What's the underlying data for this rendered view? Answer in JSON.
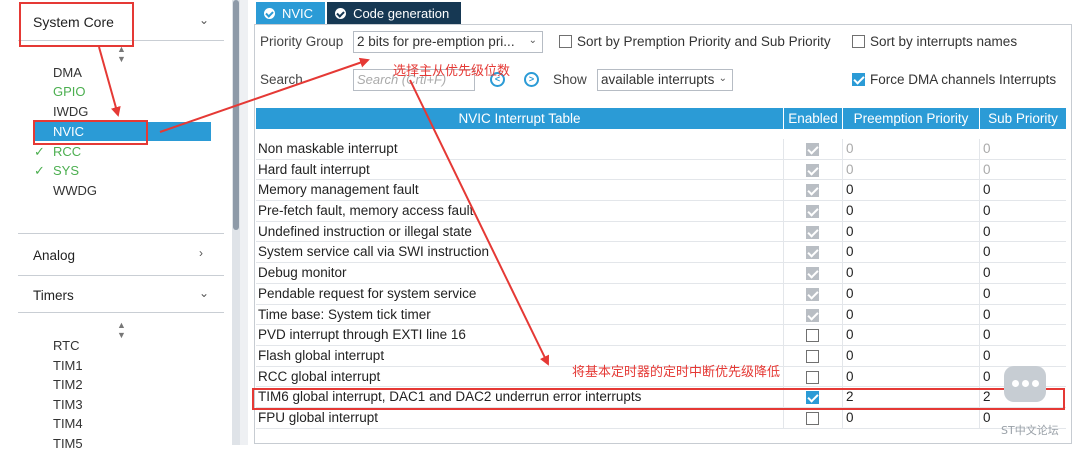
{
  "sidebar": {
    "system_core": {
      "title": "System Core",
      "items": [
        {
          "label": "DMA",
          "status": "none"
        },
        {
          "label": "GPIO",
          "status": "green"
        },
        {
          "label": "IWDG",
          "status": "none"
        },
        {
          "label": "NVIC",
          "status": "selected"
        },
        {
          "label": "RCC",
          "status": "checked"
        },
        {
          "label": "SYS",
          "status": "checked"
        },
        {
          "label": "WWDG",
          "status": "none"
        }
      ]
    },
    "analog": {
      "title": "Analog"
    },
    "timers": {
      "title": "Timers",
      "items": [
        "RTC",
        "TIM1",
        "TIM2",
        "TIM3",
        "TIM4",
        "TIM5"
      ]
    }
  },
  "tabs": [
    {
      "label": "NVIC"
    },
    {
      "label": "Code generation"
    }
  ],
  "options": {
    "priority_group_label": "Priority Group",
    "priority_group_value": "2 bits for pre-emption pri...",
    "sort_premption_label": "Sort by Premption Priority and Sub Priority",
    "sort_premption_checked": false,
    "sort_names_label": "Sort by interrupts names",
    "sort_names_checked": false,
    "search_label": "Search",
    "search_placeholder": "Search (Crtl+F)",
    "show_label": "Show",
    "show_value": "available interrupts",
    "force_dma_label": "Force DMA channels Interrupts",
    "force_dma_checked": true
  },
  "table": {
    "headers": [
      "NVIC Interrupt Table",
      "Enabled",
      "Preemption Priority",
      "Sub Priority"
    ],
    "rows": [
      {
        "name": "Non maskable interrupt",
        "enabled": true,
        "locked": true,
        "preemption": "0",
        "sub": "0",
        "dim": true
      },
      {
        "name": "Hard fault interrupt",
        "enabled": true,
        "locked": true,
        "preemption": "0",
        "sub": "0",
        "dim": true
      },
      {
        "name": "Memory management fault",
        "enabled": true,
        "locked": true,
        "preemption": "0",
        "sub": "0",
        "dim": false
      },
      {
        "name": "Pre-fetch fault, memory access fault",
        "enabled": true,
        "locked": true,
        "preemption": "0",
        "sub": "0",
        "dim": false
      },
      {
        "name": "Undefined instruction or illegal state",
        "enabled": true,
        "locked": true,
        "preemption": "0",
        "sub": "0",
        "dim": false
      },
      {
        "name": "System service call via SWI instruction",
        "enabled": true,
        "locked": true,
        "preemption": "0",
        "sub": "0",
        "dim": false
      },
      {
        "name": "Debug monitor",
        "enabled": true,
        "locked": true,
        "preemption": "0",
        "sub": "0",
        "dim": false
      },
      {
        "name": "Pendable request for system service",
        "enabled": true,
        "locked": true,
        "preemption": "0",
        "sub": "0",
        "dim": false
      },
      {
        "name": "Time base: System tick timer",
        "enabled": true,
        "locked": true,
        "preemption": "0",
        "sub": "0",
        "dim": false
      },
      {
        "name": "PVD interrupt through EXTI line 16",
        "enabled": false,
        "locked": false,
        "preemption": "0",
        "sub": "0",
        "dim": false
      },
      {
        "name": "Flash global interrupt",
        "enabled": false,
        "locked": false,
        "preemption": "0",
        "sub": "0",
        "dim": false
      },
      {
        "name": "RCC global interrupt",
        "enabled": false,
        "locked": false,
        "preemption": "0",
        "sub": "0",
        "dim": false
      },
      {
        "name": "TIM6 global interrupt, DAC1 and DAC2 underrun error interrupts",
        "enabled": true,
        "locked": false,
        "preemption": "2",
        "sub": "2",
        "dim": false
      },
      {
        "name": "FPU global interrupt",
        "enabled": false,
        "locked": false,
        "preemption": "0",
        "sub": "0",
        "dim": false
      }
    ]
  },
  "annotations": {
    "priority_note": "选择主从优先级位数",
    "timer_note": "将基本定时器的定时中断优先级降低",
    "watermark": "ST中文论坛",
    "color": "#e53935"
  },
  "colors": {
    "accent": "#2b9bd6",
    "tab_inactive": "#163853",
    "enabled_green": "#4caf50"
  }
}
